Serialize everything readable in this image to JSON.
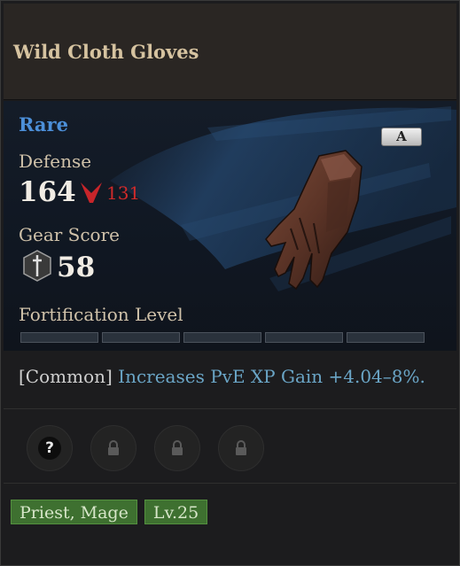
{
  "item": {
    "name": "Wild Cloth Gloves",
    "rarity": "Rare",
    "grade": "A",
    "defense_label": "Defense",
    "defense_value": "164",
    "defense_compare": "131",
    "gear_score_label": "Gear Score",
    "gear_score_value": "58",
    "fortification_label": "Fortification Level",
    "fortification_segments": 5,
    "fortification_filled": 0
  },
  "effect": {
    "tag": "[Common]",
    "description": "Increases PvE XP Gain +4.04–8%."
  },
  "sockets": [
    {
      "icon": "question-icon",
      "state": "unknown"
    },
    {
      "icon": "lock-icon",
      "state": "locked"
    },
    {
      "icon": "lock-icon",
      "state": "locked"
    },
    {
      "icon": "lock-icon",
      "state": "locked"
    }
  ],
  "requirements": {
    "classes": "Priest, Mage",
    "level": "Lv.25"
  },
  "colors": {
    "rarity": "#4c8fd8",
    "compare_down": "#d12a2a",
    "effect_text": "#6aa5c6",
    "title": "#d6c3a0",
    "requirement_tag": "#3e7030"
  }
}
